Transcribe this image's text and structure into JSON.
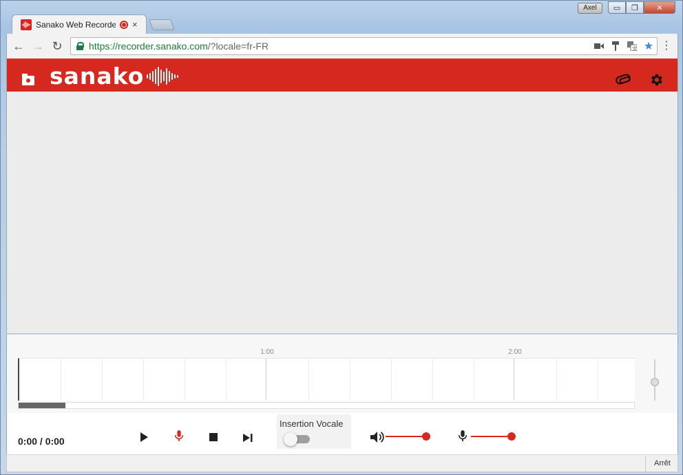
{
  "window": {
    "user_badge": "Axel",
    "controls": {
      "minimize": "▭",
      "maximize": "❐",
      "close": "✕"
    }
  },
  "browser": {
    "tab_title": "Sanako Web Recorder",
    "tab_close": "×",
    "nav": {
      "back": "←",
      "forward": "→",
      "reload": "↻"
    },
    "url_secure_part": "https://recorder.sanako.com",
    "url_rest_part": "/?locale=fr-FR",
    "menu": "⋮",
    "icons": [
      "camera-icon",
      "paintbrush-icon",
      "translate-icon",
      "star-icon"
    ]
  },
  "app": {
    "logo_text": "sanako",
    "brand_color": "#d5291f"
  },
  "timeline": {
    "tick_labels": [
      "1:00",
      "2:00"
    ],
    "scroll_position": 0.076
  },
  "controls": {
    "time": "0:00 / 0:00",
    "insertion_label": "Insertion Vocale",
    "insertion_enabled": false,
    "playback_volume": 1.0,
    "mic_volume": 1.0
  },
  "status": {
    "text": "Arrêt"
  }
}
